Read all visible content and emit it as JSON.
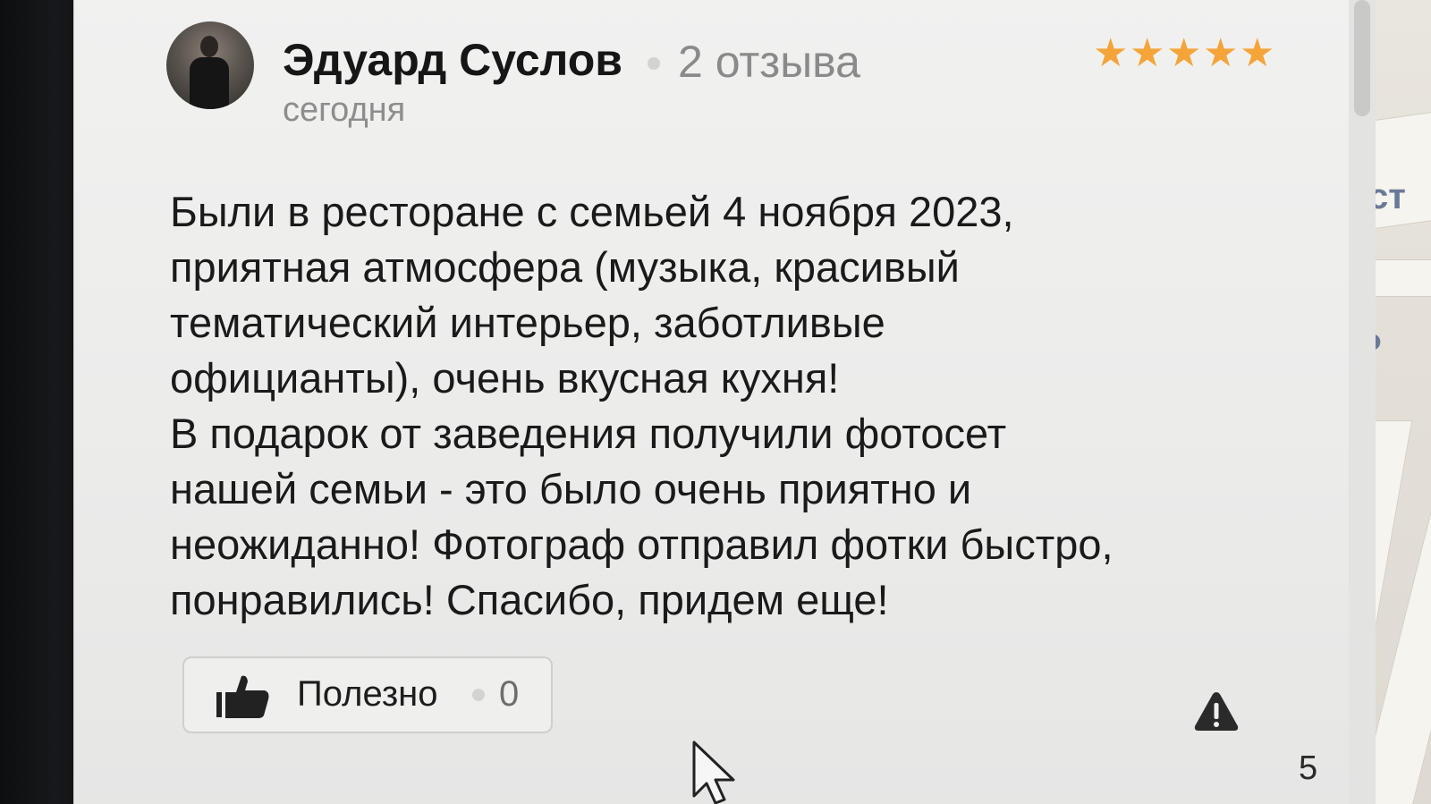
{
  "review": {
    "author_name": "Эдуард Суслов",
    "review_count": "2 отзыва",
    "date": "сегодня",
    "rating": 5,
    "rating_max": 5,
    "star_color": "#f5a43a",
    "text_lines": [
      "Были в ресторане с семьей 4 ноября 2023,",
      "приятная атмосфера (музыка, красивый",
      "тематический интерьер, заботливые",
      "официанты), очень вкусная кухня!",
      "В подарок от заведения получили фотосет",
      "нашей семьи - это было очень приятно и",
      "неожиданно! Фотограф отправил фотки быстро,",
      "понравились! Спасибо, придем еще!"
    ],
    "useful_label": "Полезно",
    "useful_count": "0"
  },
  "icons": {
    "avatar": "user-avatar",
    "thumb": "thumbs-up-icon",
    "warning": "report-warning-icon",
    "cursor": "mouse-cursor"
  },
  "map": {
    "label_top": "ст",
    "label_parking": "P"
  },
  "page_number": "5"
}
